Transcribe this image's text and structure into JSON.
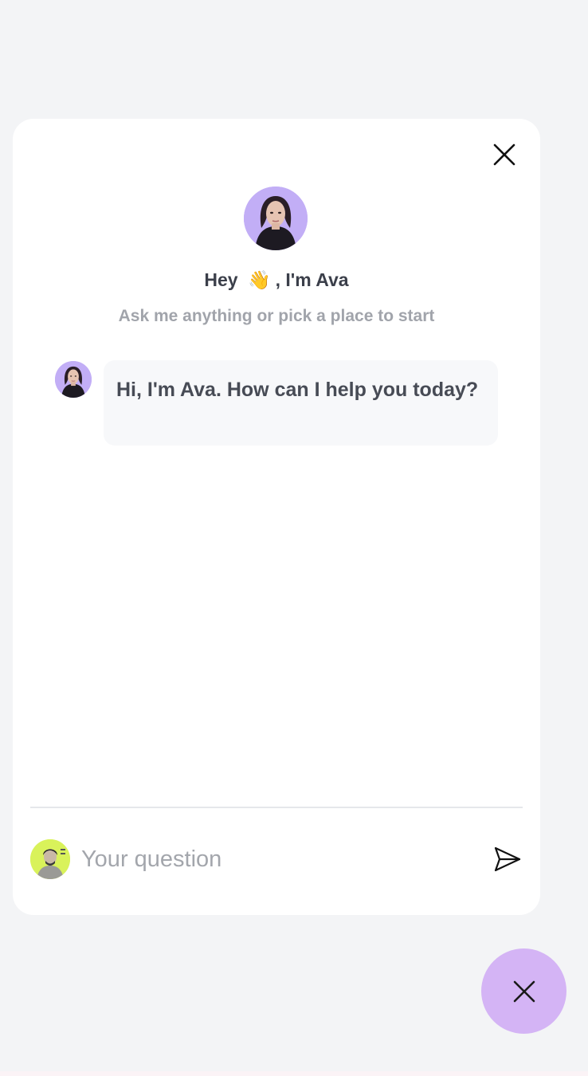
{
  "widget": {
    "greeting_prefix": "Hey",
    "greeting_emoji": "👋",
    "greeting_suffix": ", I'm Ava",
    "subtitle": "Ask me anything or pick a place to start",
    "close_icon": "close-icon",
    "avatar_name": "Ava"
  },
  "messages": [
    {
      "sender": "Ava",
      "text": "Hi, I'm Ava. How can I help you today?"
    }
  ],
  "composer": {
    "placeholder": "Your question",
    "value": "",
    "send_icon": "send-icon"
  },
  "launcher": {
    "icon": "close-icon"
  },
  "colors": {
    "page_background": "#f3f4f6",
    "panel_background": "#ffffff",
    "avatar_background": "#c2aef6",
    "launcher_background": "#d4b4f5",
    "bubble_background": "#f7f8fa"
  }
}
